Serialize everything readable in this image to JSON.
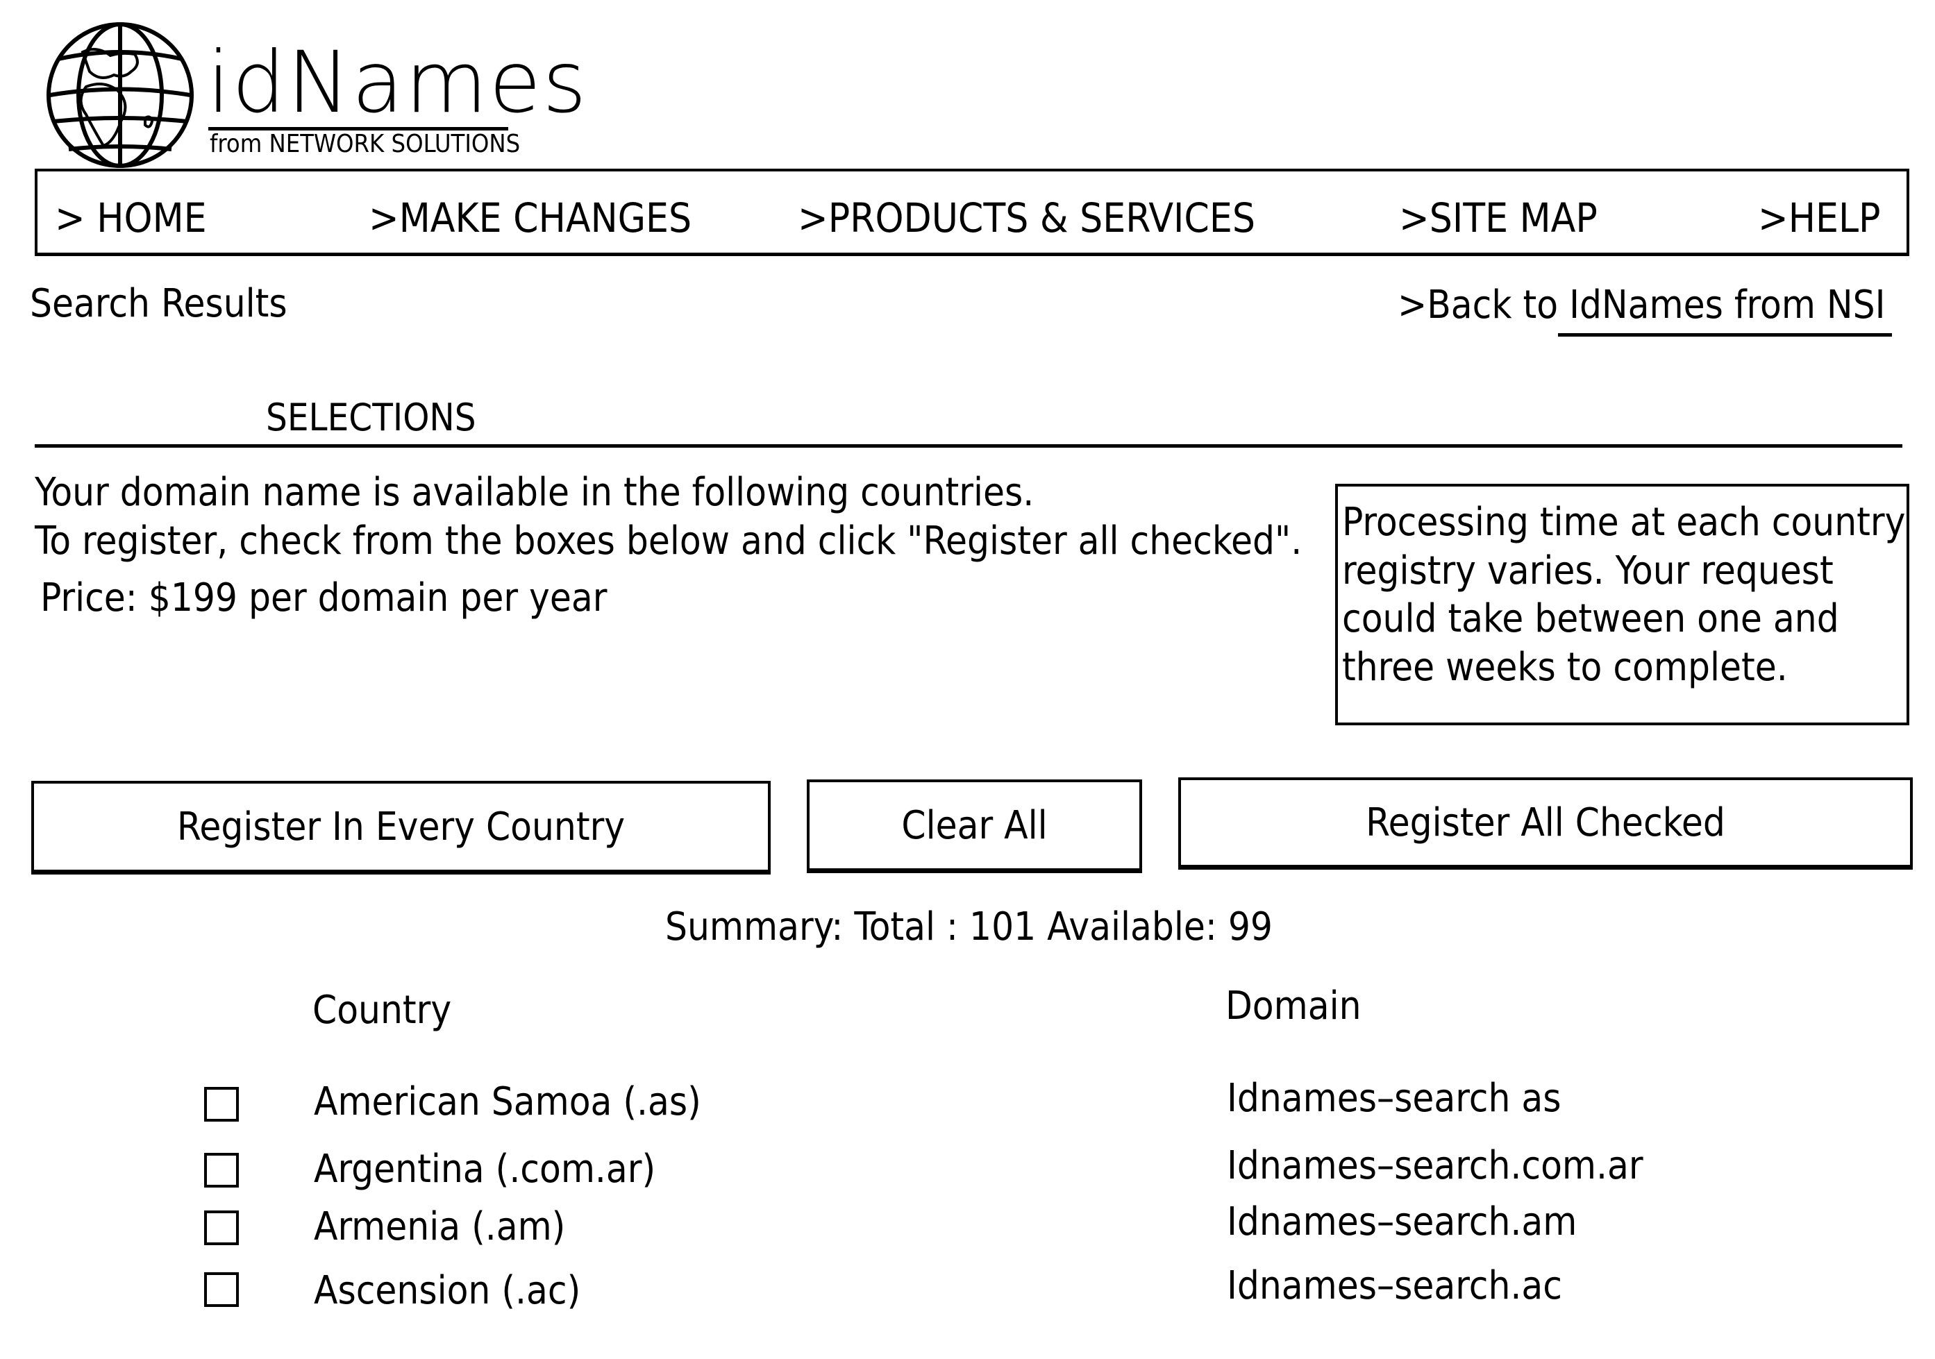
{
  "logo": {
    "icon": "globe-icon",
    "wordmark": "idNames",
    "subtitle": "from NETWORK SOLUTIONS"
  },
  "nav": {
    "items": [
      {
        "label": "> HOME"
      },
      {
        "label": ">MAKE  CHANGES"
      },
      {
        "label": ">PRODUCTS  &  SERVICES"
      },
      {
        "label": ">SITE  MAP"
      },
      {
        "label": ">HELP"
      }
    ]
  },
  "page": {
    "subtitle": "Search  Results",
    "back_prefix": ">Back  to",
    "back_link": " IdNames  from  NSI",
    "section_heading": "SELECTIONS"
  },
  "intro": {
    "line1": "Your  domain  name  is  available  in  the  following  countries.",
    "line2": "To  register,  check  from  the  boxes  below  and  click  \"Register  all  checked\".",
    "line3": "Price:  $199  per  domain  per  year"
  },
  "info_box": {
    "lines": [
      "Processing  time  at  each  country",
      "registry  varies.  Your  request",
      "could  take  between  one  and",
      "three  weeks  to  complete."
    ]
  },
  "buttons": {
    "register_every": "Register  In  Every  Country",
    "clear_all": "Clear  All",
    "register_checked": "Register  All  Checked"
  },
  "summary": {
    "text": "Summary:  Total  :  101  Available:  99",
    "total": 101,
    "available": 99
  },
  "table": {
    "columns": [
      "Country",
      "Domain"
    ],
    "rows": [
      {
        "country": "American  Samoa  (.as)",
        "domain": "Idnames–search  as",
        "checked": false
      },
      {
        "country": "Argentina  (.com.ar)",
        "domain": "Idnames–search.com.ar",
        "checked": false
      },
      {
        "country": "Armenia  (.am)",
        "domain": "Idnames–search.am",
        "checked": false
      },
      {
        "country": "Ascension  (.ac)",
        "domain": "Idnames–search.ac",
        "checked": false
      }
    ]
  }
}
